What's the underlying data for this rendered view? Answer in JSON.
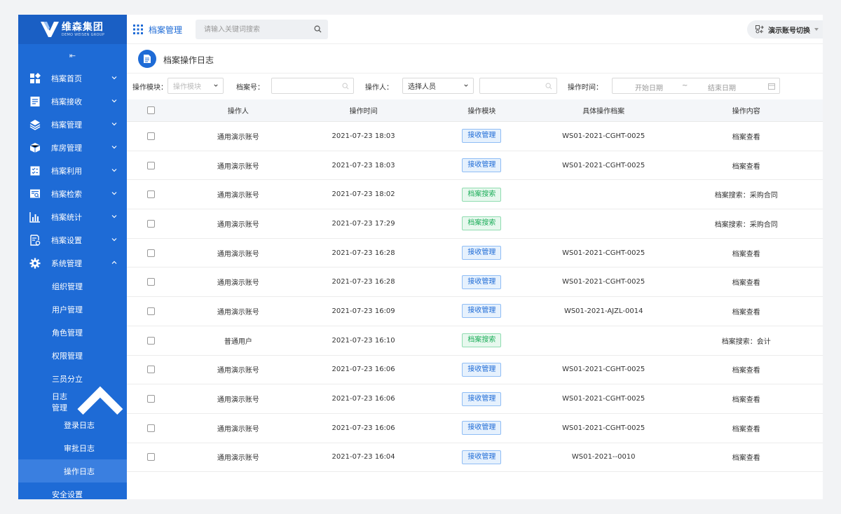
{
  "brand": {
    "name": "维森集团",
    "sub": "DEMO WEISEN GROUP"
  },
  "sidebar": {
    "collapse_glyph": "⇤",
    "items": [
      {
        "label": "档案首页",
        "icon": "dashboard-icon"
      },
      {
        "label": "档案接收",
        "icon": "inbox-doc-icon"
      },
      {
        "label": "档案管理",
        "icon": "layers-icon"
      },
      {
        "label": "库房管理",
        "icon": "box-icon"
      },
      {
        "label": "档案利用",
        "icon": "checklist-icon"
      },
      {
        "label": "档案检索",
        "icon": "search-doc-icon"
      },
      {
        "label": "档案统计",
        "icon": "bar-chart-icon"
      },
      {
        "label": "档案设置",
        "icon": "doc-settings-icon"
      },
      {
        "label": "系统管理",
        "icon": "gear-icon"
      }
    ],
    "system_children": [
      "组织管理",
      "用户管理",
      "角色管理",
      "权限管理",
      "三员分立",
      "日志管理"
    ],
    "log_children": [
      "登录日志",
      "审批日志",
      "操作日志"
    ],
    "last_item": "安全设置"
  },
  "topbar": {
    "module_title": "档案管理",
    "search_placeholder": "请输入关键词搜索",
    "account_switch": "演示账号切换"
  },
  "page": {
    "title": "档案操作日志"
  },
  "filters": {
    "module_label": "操作模块：",
    "module_placeholder": "操作模块",
    "file_no_label": "档案号：",
    "operator_label": "操作人：",
    "operator_value": "选择人员",
    "time_label": "操作时间：",
    "start_date": "开始日期",
    "range_sep": "~",
    "end_date": "结束日期"
  },
  "table": {
    "headers": [
      "操作人",
      "操作时间",
      "操作模块",
      "具体操作档案",
      "操作内容"
    ],
    "rows": [
      {
        "operator": "通用演示账号",
        "time": "2021-07-23 18:03",
        "module": "接收管理",
        "module_type": "blue",
        "file": "WS01-2021-CGHT-0025",
        "content": "档案查看"
      },
      {
        "operator": "通用演示账号",
        "time": "2021-07-23 18:03",
        "module": "接收管理",
        "module_type": "blue",
        "file": "WS01-2021-CGHT-0025",
        "content": "档案查看"
      },
      {
        "operator": "通用演示账号",
        "time": "2021-07-23 18:02",
        "module": "档案搜索",
        "module_type": "green",
        "file": "",
        "content": "档案搜索：采购合同"
      },
      {
        "operator": "通用演示账号",
        "time": "2021-07-23 17:29",
        "module": "档案搜索",
        "module_type": "green",
        "file": "",
        "content": "档案搜索：采购合同"
      },
      {
        "operator": "通用演示账号",
        "time": "2021-07-23 16:28",
        "module": "接收管理",
        "module_type": "blue",
        "file": "WS01-2021-CGHT-0025",
        "content": "档案查看"
      },
      {
        "operator": "通用演示账号",
        "time": "2021-07-23 16:28",
        "module": "接收管理",
        "module_type": "blue",
        "file": "WS01-2021-CGHT-0025",
        "content": "档案查看"
      },
      {
        "operator": "通用演示账号",
        "time": "2021-07-23 16:09",
        "module": "接收管理",
        "module_type": "blue",
        "file": "WS01-2021-AJZL-0014",
        "content": "档案查看"
      },
      {
        "operator": "普通用户",
        "time": "2021-07-23 16:10",
        "module": "档案搜索",
        "module_type": "green",
        "file": "",
        "content": "档案搜索：会计"
      },
      {
        "operator": "通用演示账号",
        "time": "2021-07-23 16:06",
        "module": "接收管理",
        "module_type": "blue",
        "file": "WS01-2021-CGHT-0025",
        "content": "档案查看"
      },
      {
        "operator": "通用演示账号",
        "time": "2021-07-23 16:06",
        "module": "接收管理",
        "module_type": "blue",
        "file": "WS01-2021-CGHT-0025",
        "content": "档案查看"
      },
      {
        "operator": "通用演示账号",
        "time": "2021-07-23 16:06",
        "module": "接收管理",
        "module_type": "blue",
        "file": "WS01-2021-CGHT-0025",
        "content": "档案查看"
      },
      {
        "operator": "通用演示账号",
        "time": "2021-07-23 16:04",
        "module": "接收管理",
        "module_type": "blue",
        "file": "WS01-2021--0010",
        "content": "档案查看"
      }
    ]
  },
  "colors": {
    "primary": "#1e6bd6",
    "tag_blue_bg": "#e6f1fd",
    "tag_blue_border": "#8fbdf5",
    "tag_blue_text": "#1e6bd6",
    "tag_green_bg": "#e7f8ee",
    "tag_green_border": "#8fdcb0",
    "tag_green_text": "#1fae5b"
  }
}
